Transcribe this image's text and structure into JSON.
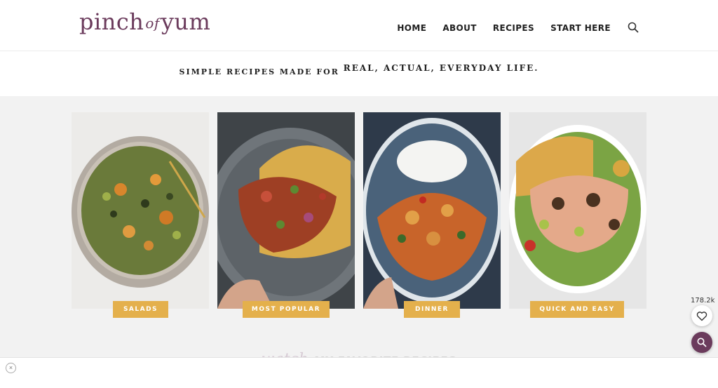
{
  "brand": {
    "logo_left": "pinch",
    "logo_of": "of",
    "logo_right": "yum"
  },
  "nav": {
    "items": [
      "HOME",
      "ABOUT",
      "RECIPES",
      "START HERE"
    ]
  },
  "tagline": {
    "part1": "SIMPLE RECIPES MADE FOR",
    "part2": "REAL, ACTUAL, EVERYDAY LIFE."
  },
  "categories": [
    {
      "label": "SALADS"
    },
    {
      "label": "MOST POPULAR"
    },
    {
      "label": "DINNER"
    },
    {
      "label": "QUICK AND EASY"
    }
  ],
  "promo": {
    "watch": "watch",
    "title": "MY FAVORITE RECIPES"
  },
  "widgets": {
    "save_count": "178.2k",
    "close_symbol": "×"
  },
  "colors": {
    "accent": "#6b3b5c",
    "badge": "#e4b04c"
  },
  "icons": [
    "search-icon",
    "heart-icon",
    "close-icon"
  ]
}
